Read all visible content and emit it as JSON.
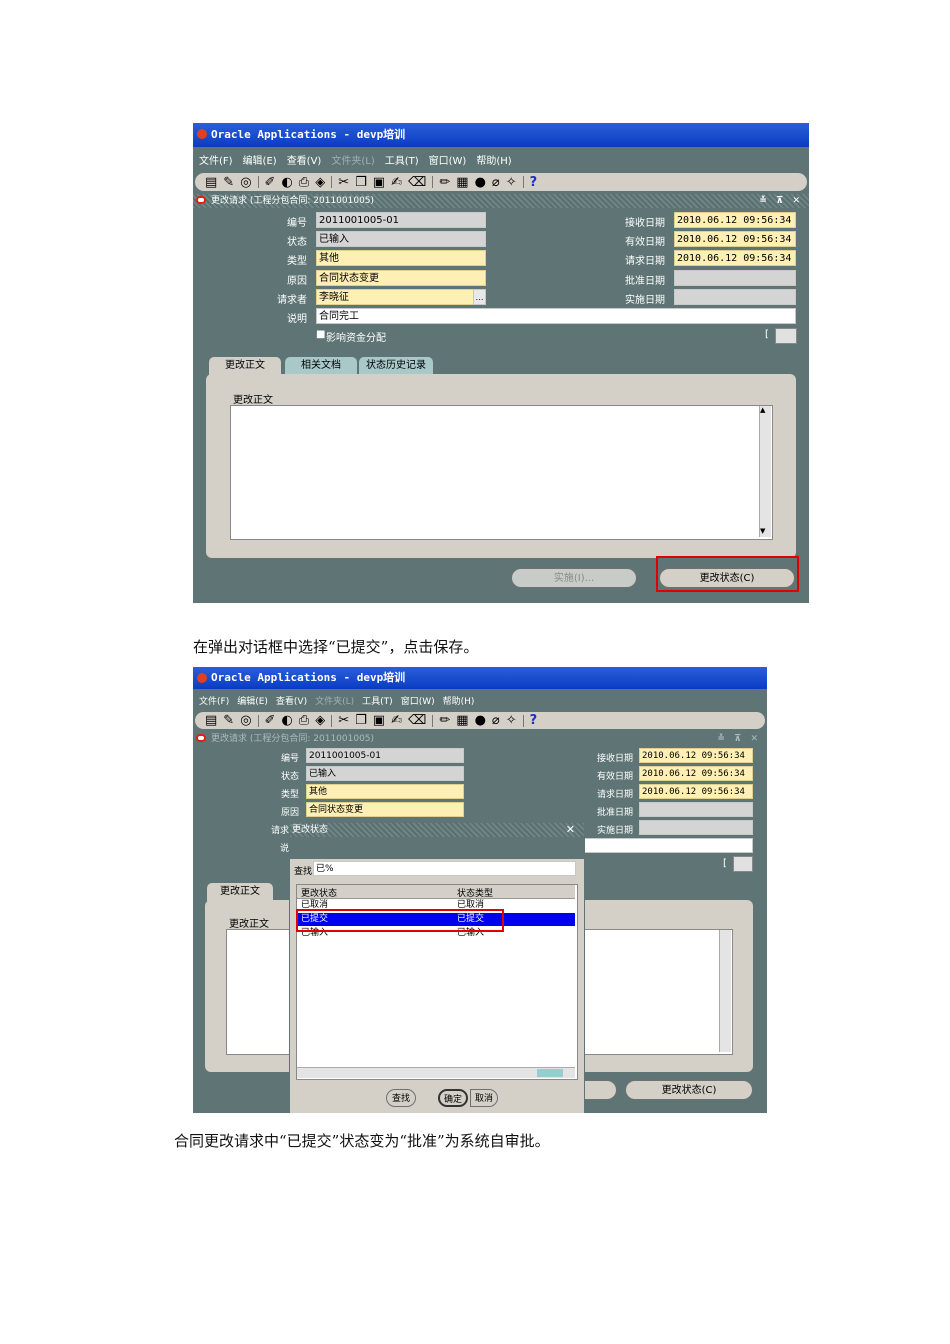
{
  "screen1": {
    "title": "Oracle Applications - devp培训",
    "menu": [
      "文件(F)",
      "编辑(E)",
      "查看(V)",
      "文件夹(L)",
      "工具(T)",
      "窗口(W)",
      "帮助(H)"
    ],
    "window_title": "更改请求 (工程分包合同: 2011001005)",
    "window_controls": "≚ ⊼ ✕",
    "fields": {
      "number_label": "编号",
      "number_value": "2011001005-01",
      "status_label": "状态",
      "status_value": "已输入",
      "type_label": "类型",
      "type_value": "其他",
      "reason_label": "原因",
      "reason_value": "合同状态变更",
      "requester_label": "请求者",
      "requester_value": "李晓征",
      "desc_label": "说明",
      "desc_value": "合同完工",
      "received_label": "接收日期",
      "received_value": "2010.06.12 09:56:34",
      "effective_label": "有效日期",
      "effective_value": "2010.06.12 09:56:34",
      "request_date_label": "请求日期",
      "request_date_value": "2010.06.12 09:56:34",
      "approve_label": "批准日期",
      "approve_value": "",
      "implement_label": "实施日期",
      "implement_value": ""
    },
    "checkbox_label": "影响资金分配",
    "bracket": "[",
    "tabs": [
      "更改正文",
      "相关文档",
      "状态历史记录"
    ],
    "body_label": "更改正文",
    "implement_button": "实施(I)...",
    "change_status_button": "更改状态(C)"
  },
  "caption1": "在弹出对话框中选择“已提交”，点击保存。",
  "screen2": {
    "title": "Oracle Applications - devp培训",
    "menu": [
      "文件(F)",
      "编辑(E)",
      "查看(V)",
      "文件夹(L)",
      "工具(T)",
      "窗口(W)",
      "帮助(H)"
    ],
    "window_title": "更改请求 (工程分包合同: 2011001005)",
    "window_controls": "≚ ⊼ ✕",
    "fields": {
      "number_label": "编号",
      "number_value": "2011001005-01",
      "status_label": "状态",
      "status_value": "已输入",
      "type_label": "类型",
      "type_value": "其他",
      "reason_label": "原因",
      "reason_value": "合同状态变更",
      "requester_label": "请求",
      "desc_label": "说",
      "received_label": "接收日期",
      "received_value": "2010.06.12 09:56:34",
      "effective_label": "有效日期",
      "effective_value": "2010.06.12 09:56:34",
      "request_date_label": "请求日期",
      "request_date_value": "2010.06.12 09:56:34",
      "approve_label": "批准日期",
      "implement_label": "实施日期"
    },
    "bracket": "[",
    "tab_active": "更改正文",
    "body_label": "更改正文",
    "change_status_button": "更改状态(C)",
    "dialog": {
      "title": "更改状态",
      "close": "✕",
      "find_label": "查找",
      "find_value": "已%",
      "columns": [
        "更改状态",
        "状态类型"
      ],
      "rows": [
        {
          "status": "已取消",
          "type": "已取消",
          "selected": false
        },
        {
          "status": "已提交",
          "type": "已提交",
          "selected": true
        },
        {
          "status": "已输入",
          "type": "已输入",
          "selected": false
        }
      ],
      "find_button": "查找",
      "ok_button": "确定",
      "cancel_button": "取消"
    }
  },
  "caption2": "合同更改请求中“已提交”状态变为“批准”为系统自审批。"
}
